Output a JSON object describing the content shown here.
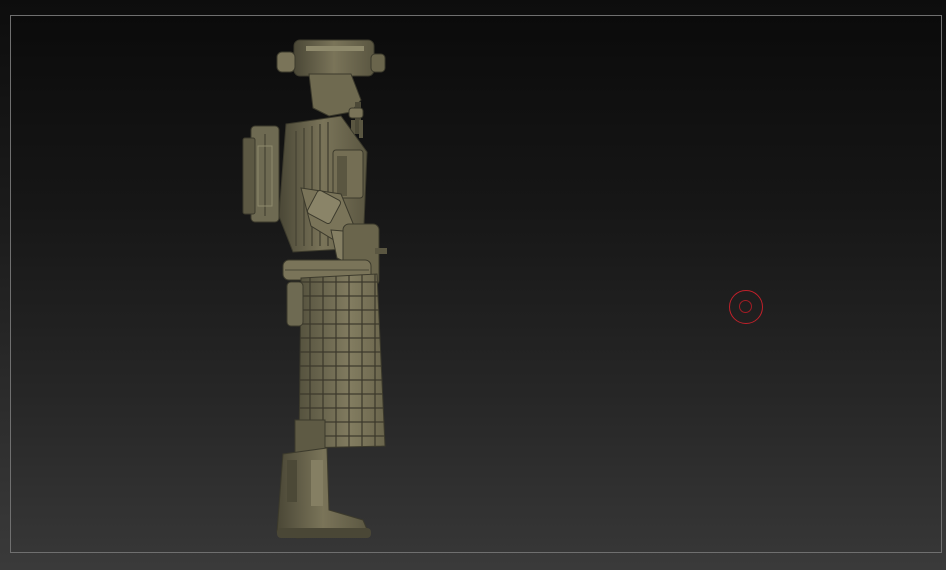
{
  "viewport": {
    "background_top": "#0b0b0b",
    "background_bottom": "#363636",
    "frame_color": "#6f6f6f"
  },
  "model": {
    "material_color": "#6e6a52",
    "highlight_color": "#8f8a6c",
    "shadow_color": "#3c3a2c"
  },
  "brush_cursor": {
    "icon": "brush-circle-icon",
    "color": "#c0202a"
  }
}
